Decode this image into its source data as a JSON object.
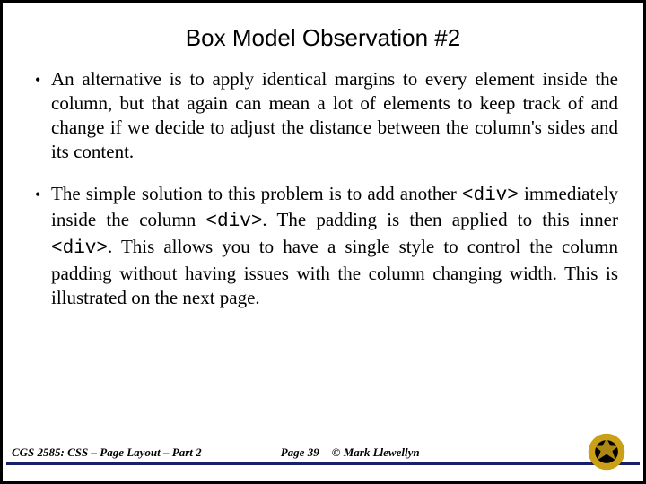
{
  "title": "Box Model Observation #2",
  "bullets": [
    {
      "text": "An alternative is to apply identical margins to every element inside the column, but that again can mean a lot of elements to keep track of and change if we decide to adjust the distance between the column's sides and its content."
    },
    {
      "segments": [
        {
          "t": "The simple solution to this problem is to add another "
        },
        {
          "t": "<div>",
          "mono": true
        },
        {
          "t": " immediately inside the column "
        },
        {
          "t": "<div>",
          "mono": true
        },
        {
          "t": ".   The padding is then applied to this inner "
        },
        {
          "t": "<div>",
          "mono": true
        },
        {
          "t": ".   This allows you to have a single style to control the column padding without having issues with the column changing width.  This is illustrated on the next page."
        }
      ]
    }
  ],
  "footer": {
    "left": "CGS 2585: CSS – Page Layout – Part 2",
    "center": "Page 39",
    "right": "© Mark Llewellyn"
  },
  "colors": {
    "logo_outer": "#c9a018",
    "logo_inner": "#000000"
  }
}
